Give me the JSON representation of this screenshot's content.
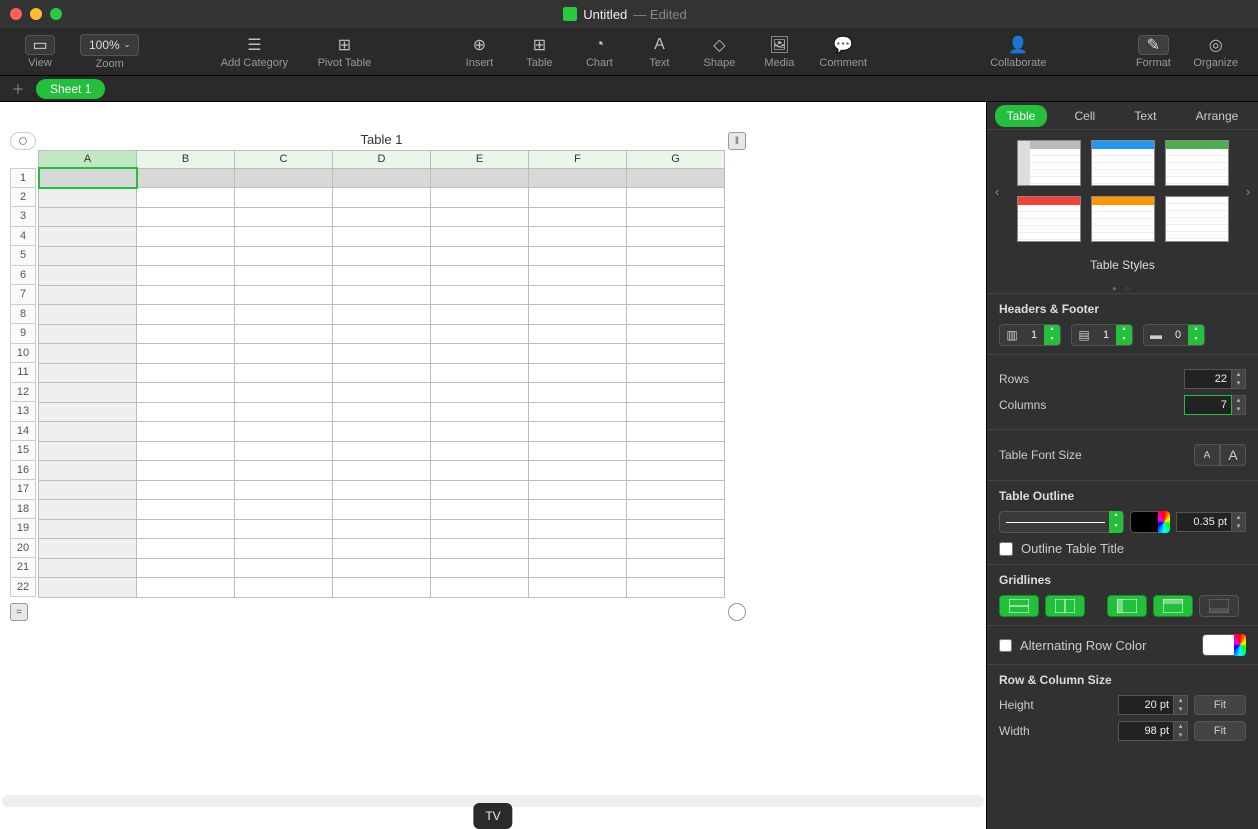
{
  "window": {
    "title": "Untitled",
    "status": "Edited"
  },
  "toolbar": {
    "view": "View",
    "zoom": "Zoom",
    "zoomValue": "100%",
    "addCategory": "Add Category",
    "pivot": "Pivot Table",
    "insert": "Insert",
    "table": "Table",
    "chart": "Chart",
    "text": "Text",
    "shape": "Shape",
    "media": "Media",
    "comment": "Comment",
    "collaborate": "Collaborate",
    "format": "Format",
    "organize": "Organize"
  },
  "sheets": {
    "items": [
      "Sheet 1"
    ]
  },
  "spreadsheet": {
    "title": "Table 1",
    "columns": [
      "A",
      "B",
      "C",
      "D",
      "E",
      "F",
      "G"
    ],
    "rows": [
      "1",
      "2",
      "3",
      "4",
      "5",
      "6",
      "7",
      "8",
      "9",
      "10",
      "11",
      "12",
      "13",
      "14",
      "15",
      "16",
      "17",
      "18",
      "19",
      "20",
      "21",
      "22"
    ],
    "selectedCell": "A1"
  },
  "inspector": {
    "tabs": {
      "table": "Table",
      "cell": "Cell",
      "text": "Text",
      "arrange": "Arrange"
    },
    "tableStylesLabel": "Table Styles",
    "headersFooter": {
      "label": "Headers & Footer",
      "headerCols": "1",
      "headerRows": "1",
      "footerRows": "0"
    },
    "rows": {
      "label": "Rows",
      "value": "22"
    },
    "cols": {
      "label": "Columns",
      "value": "7"
    },
    "fontSizeLabel": "Table Font Size",
    "outline": {
      "label": "Table Outline",
      "width": "0.35 pt",
      "titleLabel": "Outline Table Title"
    },
    "gridlinesLabel": "Gridlines",
    "altRowLabel": "Alternating Row Color",
    "rowColSize": {
      "label": "Row & Column Size",
      "heightLabel": "Height",
      "height": "20 pt",
      "widthLabel": "Width",
      "width": "98 pt",
      "fit": "Fit"
    }
  },
  "dock": {
    "tooltip": "TV"
  }
}
